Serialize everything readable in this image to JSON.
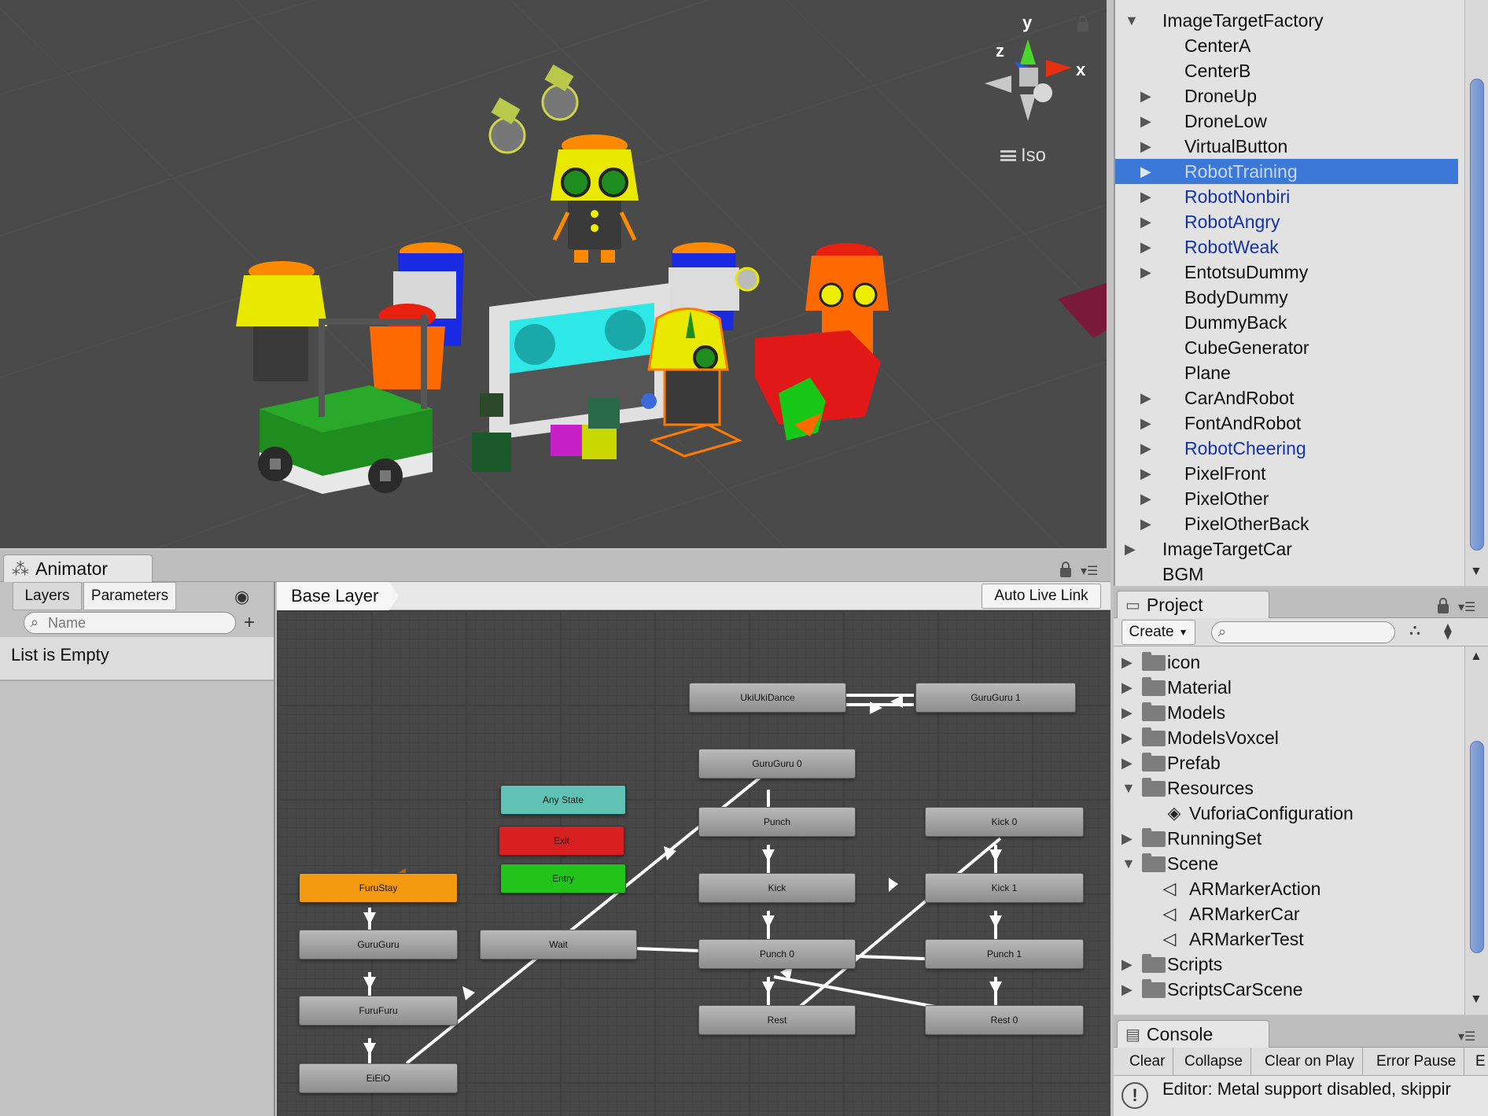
{
  "scene": {
    "view_mode": "Iso",
    "gizmo_axes": {
      "x": "x",
      "y": "y",
      "z": "z"
    },
    "colors": {
      "background": "#4a4a4a",
      "selection_outline": "#ff7a00"
    }
  },
  "hierarchy": {
    "items": [
      {
        "label": "ImageTargetFactory",
        "expanded": true,
        "level": 0,
        "has_children": true
      },
      {
        "label": "CenterA",
        "level": 1,
        "has_children": false
      },
      {
        "label": "CenterB",
        "level": 1,
        "has_children": false
      },
      {
        "label": "DroneUp",
        "level": 1,
        "has_children": true
      },
      {
        "label": "DroneLow",
        "level": 1,
        "has_children": true
      },
      {
        "label": "VirtualButton",
        "level": 1,
        "has_children": true
      },
      {
        "label": "RobotTraining",
        "level": 1,
        "has_children": true,
        "selected": true,
        "prefab": true
      },
      {
        "label": "RobotNonbiri",
        "level": 1,
        "has_children": true,
        "prefab": true
      },
      {
        "label": "RobotAngry",
        "level": 1,
        "has_children": true,
        "prefab": true
      },
      {
        "label": "RobotWeak",
        "level": 1,
        "has_children": true,
        "prefab": true
      },
      {
        "label": "EntotsuDummy",
        "level": 1,
        "has_children": true
      },
      {
        "label": "BodyDummy",
        "level": 1,
        "has_children": false
      },
      {
        "label": "DummyBack",
        "level": 1,
        "has_children": false
      },
      {
        "label": "CubeGenerator",
        "level": 1,
        "has_children": false
      },
      {
        "label": "Plane",
        "level": 1,
        "has_children": false
      },
      {
        "label": "CarAndRobot",
        "level": 1,
        "has_children": true
      },
      {
        "label": "FontAndRobot",
        "level": 1,
        "has_children": true
      },
      {
        "label": "RobotCheering",
        "level": 1,
        "has_children": true,
        "prefab": true
      },
      {
        "label": "PixelFront",
        "level": 1,
        "has_children": true
      },
      {
        "label": "PixelOther",
        "level": 1,
        "has_children": true
      },
      {
        "label": "PixelOtherBack",
        "level": 1,
        "has_children": true
      },
      {
        "label": "ImageTargetCar",
        "level": 0,
        "has_children": true
      },
      {
        "label": "BGM",
        "level": 0,
        "has_children": false
      }
    ],
    "selected_color": "#3c78d8",
    "prefab_color": "#1533a8"
  },
  "animator": {
    "tab_label": "Animator",
    "subtabs": {
      "layers": "Layers",
      "parameters": "Parameters"
    },
    "search_placeholder": "Name",
    "empty_message": "List is Empty",
    "breadcrumb": "Base Layer",
    "auto_live_link": "Auto Live Link",
    "states": {
      "ukiukidance": "UkiUkiDance",
      "guruguru1": "GuruGuru 1",
      "guruguru0": "GuruGuru 0",
      "anystate": "Any State",
      "exit": "Exit",
      "entry": "Entry",
      "furustay": "FuruStay",
      "guruguru": "GuruGuru",
      "furufuru": "FuruFuru",
      "eieio": "EiEiO",
      "wait": "Wait",
      "punch": "Punch",
      "kick": "Kick",
      "punch0": "Punch 0",
      "rest": "Rest",
      "kick0": "Kick 0",
      "kick1": "Kick 1",
      "punch1": "Punch 1",
      "rest0": "Rest 0"
    },
    "colors": {
      "anystate": "#5fc2b4",
      "exit": "#d82020",
      "entry": "#22c41c",
      "default_state": "#f39a10",
      "normal_state": "#9c9c9c"
    }
  },
  "project": {
    "tab_label": "Project",
    "create_label": "Create",
    "items": [
      {
        "label": "icon",
        "type": "folder",
        "level": 0,
        "expanded": false
      },
      {
        "label": "Material",
        "type": "folder",
        "level": 0,
        "expanded": false
      },
      {
        "label": "Models",
        "type": "folder",
        "level": 0,
        "expanded": false
      },
      {
        "label": "ModelsVoxcel",
        "type": "folder",
        "level": 0,
        "expanded": false
      },
      {
        "label": "Prefab",
        "type": "folder",
        "level": 0,
        "expanded": false
      },
      {
        "label": "Resources",
        "type": "folder",
        "level": 0,
        "expanded": true
      },
      {
        "label": "VuforiaConfiguration",
        "type": "asset",
        "level": 1
      },
      {
        "label": "RunningSet",
        "type": "folder",
        "level": 0,
        "expanded": false
      },
      {
        "label": "Scene",
        "type": "folder",
        "level": 0,
        "expanded": true
      },
      {
        "label": "ARMarkerAction",
        "type": "scene",
        "level": 1
      },
      {
        "label": "ARMarkerCar",
        "type": "scene",
        "level": 1
      },
      {
        "label": "ARMarkerTest",
        "type": "scene",
        "level": 1
      },
      {
        "label": "Scripts",
        "type": "folder",
        "level": 0,
        "expanded": false
      },
      {
        "label": "ScriptsCarScene",
        "type": "folder",
        "level": 0,
        "expanded": false
      }
    ]
  },
  "console": {
    "tab_label": "Console",
    "buttons": [
      "Clear",
      "Collapse",
      "Clear on Play",
      "Error Pause",
      "E"
    ],
    "message": "Editor: Metal support disabled, skippir"
  }
}
